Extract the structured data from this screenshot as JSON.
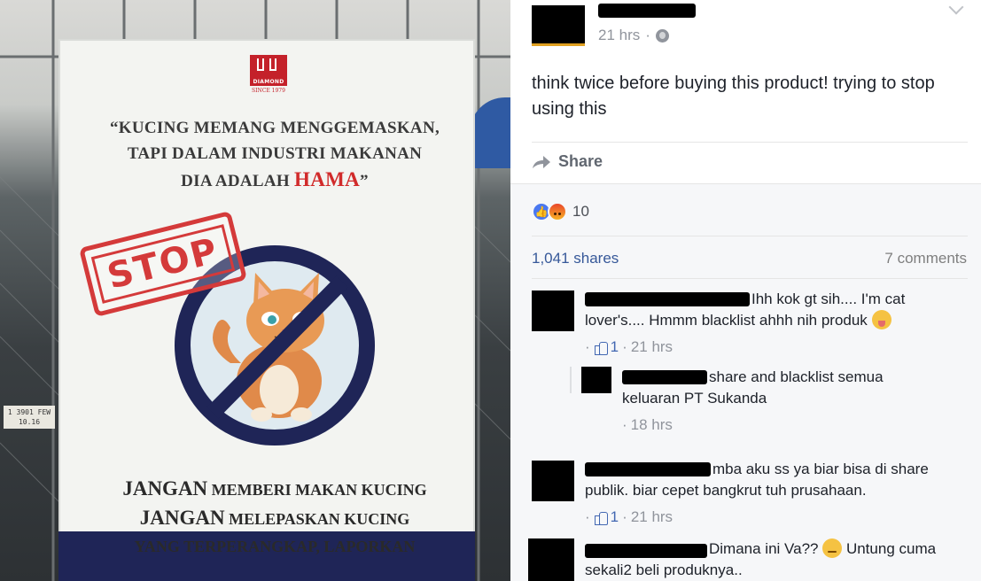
{
  "photo": {
    "sign": {
      "brand_name": "DIAMOND",
      "brand_since": "SINCE 1979",
      "quote_line1": "“KUCING MEMANG MENGGEMASKAN,",
      "quote_line2": "TAPI DALAM INDUSTRI MAKANAN",
      "quote_line3_pre": "DIA ADALAH ",
      "quote_line3_hama": "HAMA",
      "quote_line3_post": "”",
      "stamp": "STOP",
      "line1_big": "JANGAN",
      "line1_rest": " MEMBERI MAKAN KUCING",
      "line2_big": "JANGAN",
      "line2_rest": " MELEPASKAN KUCING",
      "line3": "YANG TERPERANGKAP, LAPORKAN"
    },
    "plate_line1": "1 3901 FEW",
    "plate_line2": "10.16"
  },
  "post": {
    "time": "21 hrs",
    "separator": "·",
    "text": "think twice before buying this product! trying to stop using this",
    "share_label": "Share",
    "reaction_count": "10",
    "shares": "1,041 shares",
    "comments_count": "7 comments"
  },
  "comments": [
    {
      "text_line1": "Ihh kok gt sih.... I'm cat",
      "text_line2": "lover's.... Hmmm blacklist ahhh nih produk",
      "likes": "1",
      "time": "21 hrs"
    },
    {
      "text_line1": "share and blacklist semua",
      "text_line2": "keluaran PT Sukanda",
      "time": "18 hrs"
    },
    {
      "text_line1": "mba aku ss ya biar bisa di share",
      "text_line2": "publik. biar cepet bangkrut tuh prusahaan.",
      "likes": "1",
      "time": "21 hrs"
    },
    {
      "text_line1_pre": "Dimana ini Va??",
      "text_line1_post": "Untung cuma",
      "text_line2": "sekali2 beli produknya.."
    }
  ],
  "colors": {
    "link": "#365899",
    "meta": "#90949c",
    "feedback_bg": "#f6f7f9",
    "stop_red": "#d43a3a"
  }
}
